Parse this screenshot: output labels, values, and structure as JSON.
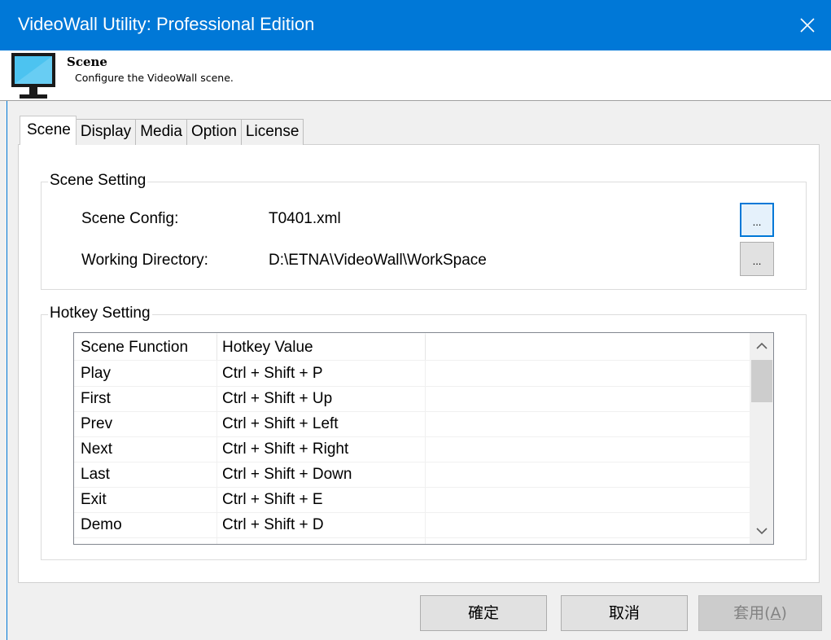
{
  "window": {
    "title": "VideoWall Utility: Professional Edition"
  },
  "header": {
    "title": "Scene",
    "subtitle": "Configure the VideoWall scene."
  },
  "tabs": [
    {
      "label": "Scene",
      "active": true
    },
    {
      "label": "Display"
    },
    {
      "label": "Media"
    },
    {
      "label": "Option"
    },
    {
      "label": "License"
    }
  ],
  "scene_setting": {
    "legend": "Scene Setting",
    "scene_config_label": "Scene Config:",
    "scene_config_value": "T0401.xml",
    "working_dir_label": "Working Directory:",
    "working_dir_value": "D:\\ETNA\\VideoWall\\WorkSpace",
    "browse_label": "..."
  },
  "hotkey_setting": {
    "legend": "Hotkey Setting",
    "columns": [
      "Scene Function",
      "Hotkey Value"
    ],
    "rows": [
      [
        "Play",
        "Ctrl + Shift + P"
      ],
      [
        "First",
        "Ctrl + Shift + Up"
      ],
      [
        "Prev",
        "Ctrl + Shift + Left"
      ],
      [
        "Next",
        "Ctrl + Shift + Right"
      ],
      [
        "Last",
        "Ctrl + Shift + Down"
      ],
      [
        "Exit",
        "Ctrl + Shift + E"
      ],
      [
        "Demo",
        "Ctrl + Shift + D"
      ]
    ]
  },
  "buttons": {
    "ok": "確定",
    "cancel": "取消",
    "apply_prefix": "套用(",
    "apply_hotkey": "A",
    "apply_suffix": ")"
  },
  "colors": {
    "titlebar": "#0078d7",
    "monitor_frame": "#1a1a1a",
    "monitor_screen": "#4cc3f0"
  },
  "icons": {
    "close": "close-icon",
    "monitor": "monitor-icon",
    "scroll_up": "chevron-up-icon",
    "scroll_down": "chevron-down-icon"
  }
}
